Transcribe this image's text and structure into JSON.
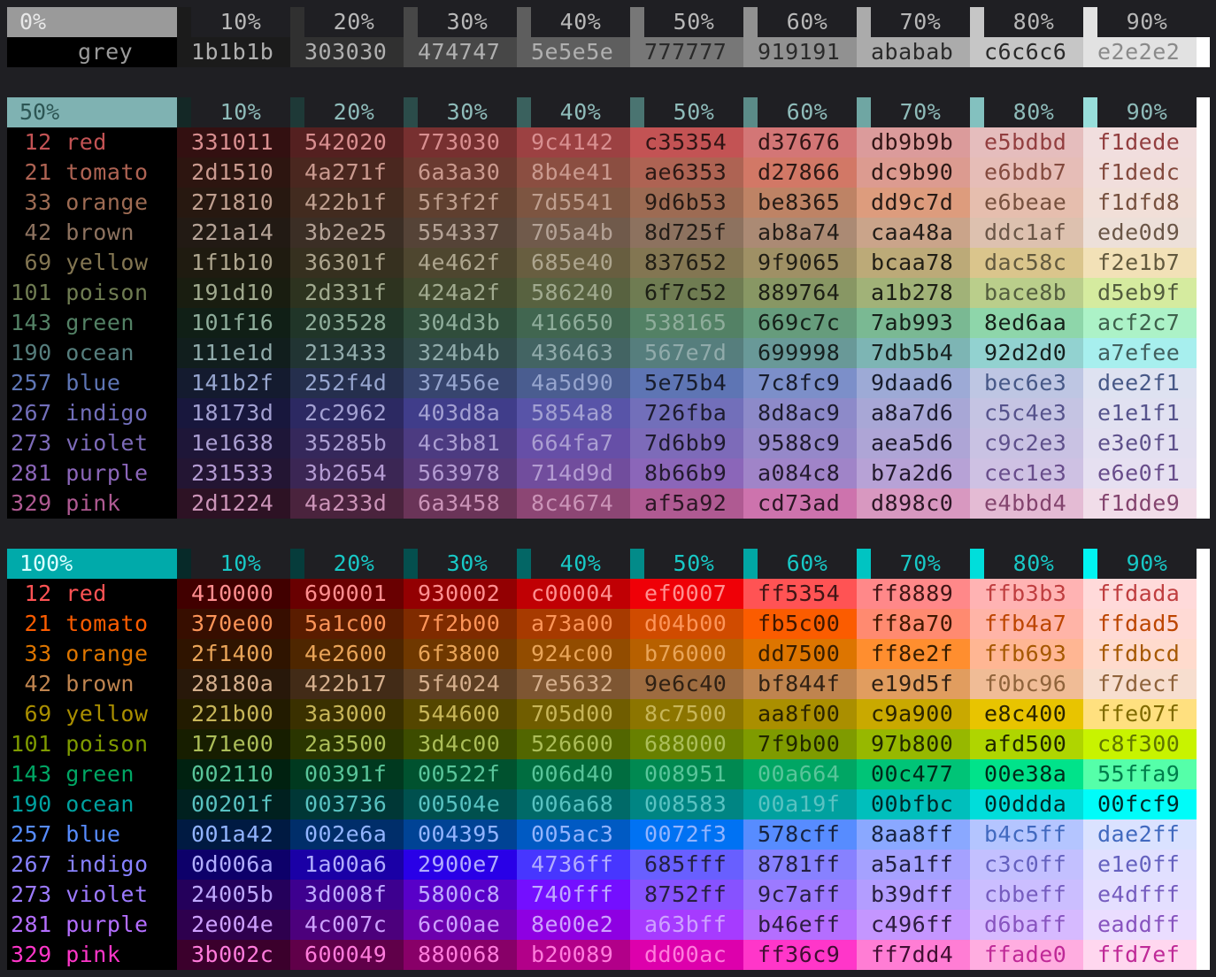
{
  "grey": {
    "header_label": "0%",
    "name": "grey",
    "percent_labels": [
      "10%",
      "20%",
      "30%",
      "40%",
      "50%",
      "60%",
      "70%",
      "80%",
      "90%"
    ],
    "values": [
      "1b1b1b",
      "303030",
      "474747",
      "5e5e5e",
      "777777",
      "919191",
      "ababab",
      "c6c6c6",
      "e2e2e2"
    ]
  },
  "mid": {
    "header_label": "50%",
    "header_color": "#7fb2b2",
    "percent_labels": [
      "10%",
      "20%",
      "30%",
      "40%",
      "50%",
      "60%",
      "70%",
      "80%",
      "90%"
    ],
    "swatch_colors": [
      "#142826",
      "#1e3937",
      "#2b4c4a",
      "#3a615e",
      "#4a7471",
      "#5b8b88",
      "#6fa6a3",
      "#83c1bf",
      "#98dedb"
    ],
    "rows": [
      {
        "label": " 12 red",
        "color": "#c35354",
        "values": [
          "331011",
          "542020",
          "773030",
          "9c4142",
          "c35354",
          "d37676",
          "db9b9b",
          "e5bdbd",
          "f1dede"
        ]
      },
      {
        "label": " 21 tomato",
        "color": "#ae6353",
        "values": [
          "2d1510",
          "4a271f",
          "6a3a30",
          "8b4e41",
          "ae6353",
          "d27866",
          "dc9b90",
          "e6bdb7",
          "f1dedc"
        ]
      },
      {
        "label": " 33 orange",
        "color": "#9d6b53",
        "values": [
          "271810",
          "422b1f",
          "5f3f2f",
          "7d5541",
          "9d6b53",
          "be8365",
          "dd9c7d",
          "e6beae",
          "f1dfd8"
        ]
      },
      {
        "label": " 42 brown",
        "color": "#8d725f",
        "values": [
          "221a14",
          "3b2e25",
          "554337",
          "705a4b",
          "8d725f",
          "ab8a74",
          "caa48a",
          "ddc1af",
          "ede0d9"
        ]
      },
      {
        "label": " 69 yellow",
        "color": "#837652",
        "values": [
          "1f1b10",
          "36301f",
          "4e462f",
          "685e40",
          "837652",
          "9f9065",
          "bcaa78",
          "dac58c",
          "f2e1b7"
        ]
      },
      {
        "label": "101 poison",
        "color": "#6f7c52",
        "values": [
          "191d10",
          "2d331f",
          "424a2f",
          "586240",
          "6f7c52",
          "889764",
          "a1b278",
          "bace8b",
          "d5eb9f"
        ]
      },
      {
        "label": "143 green",
        "color": "#538165",
        "values": [
          "101f16",
          "203528",
          "304d3b",
          "416650",
          "538165",
          "669c7c",
          "7ab993",
          "8ed6aa",
          "acf2c7"
        ]
      },
      {
        "label": "190 ocean",
        "color": "#567e7d",
        "values": [
          "111e1d",
          "213433",
          "324b4b",
          "436463",
          "567e7d",
          "699998",
          "7db5b4",
          "92d2d0",
          "a7efee"
        ]
      },
      {
        "label": "257 blue",
        "color": "#5e75b4",
        "values": [
          "141b2f",
          "252f4d",
          "37456e",
          "4a5d90",
          "5e75b4",
          "7c8fc9",
          "9daad6",
          "bec6e3",
          "dee2f1"
        ]
      },
      {
        "label": "267 indigo",
        "color": "#726fba",
        "values": [
          "18173d",
          "2c2962",
          "403d8a",
          "5854a8",
          "726fba",
          "8d8ac9",
          "a8a7d6",
          "c5c4e3",
          "e1e1f1"
        ]
      },
      {
        "label": "273 violet",
        "color": "#7d6bb9",
        "values": [
          "1e1638",
          "35285b",
          "4c3b81",
          "664fa7",
          "7d6bb9",
          "9588c9",
          "aea5d6",
          "c9c2e3",
          "e3e0f1"
        ]
      },
      {
        "label": "281 purple",
        "color": "#8b66b9",
        "values": [
          "231533",
          "3b2654",
          "563978",
          "714d9d",
          "8b66b9",
          "a084c8",
          "b7a2d6",
          "cec1e3",
          "e6e0f1"
        ]
      },
      {
        "label": "329 pink",
        "color": "#af5a92",
        "values": [
          "2d1224",
          "4a233d",
          "6a3458",
          "8c4674",
          "af5a92",
          "cd73ad",
          "d898c0",
          "e4bbd4",
          "f1dde9"
        ]
      }
    ]
  },
  "full": {
    "header_label": "100%",
    "header_color": "#00aaaa",
    "percent_labels": [
      "10%",
      "20%",
      "30%",
      "40%",
      "50%",
      "60%",
      "70%",
      "80%",
      "90%"
    ],
    "swatch_colors": [
      "#072a29",
      "#063c3b",
      "#044f4e",
      "#036665",
      "#028b89",
      "#01a6a4",
      "#00c4c2",
      "#00dedb",
      "#00f4f1"
    ],
    "rows": [
      {
        "label": " 12 red",
        "color": "#ff5354",
        "values": [
          "410000",
          "690001",
          "930002",
          "c00004",
          "ef0007",
          "ff5354",
          "ff8889",
          "ffb3b3",
          "ffdada"
        ]
      },
      {
        "label": " 21 tomato",
        "color": "#fb5c00",
        "values": [
          "370e00",
          "5a1c00",
          "7f2b00",
          "a73a00",
          "d04b00",
          "fb5c00",
          "ff8a70",
          "ffb4a7",
          "ffdad5"
        ]
      },
      {
        "label": " 33 orange",
        "color": "#dd7500",
        "values": [
          "2f1400",
          "4e2600",
          "6f3800",
          "924c00",
          "b76000",
          "dd7500",
          "ff8e2f",
          "ffb693",
          "ffdbcd"
        ]
      },
      {
        "label": " 42 brown",
        "color": "#bf844f",
        "values": [
          "28180a",
          "422b17",
          "5f4024",
          "7e5632",
          "9e6c40",
          "bf844f",
          "e19d5f",
          "f0bc96",
          "f7decf"
        ]
      },
      {
        "label": " 69 yellow",
        "color": "#aa8f00",
        "values": [
          "221b00",
          "3a3000",
          "544600",
          "705d00",
          "8c7500",
          "aa8f00",
          "c9a900",
          "e8c400",
          "ffe07f"
        ]
      },
      {
        "label": "101 poison",
        "color": "#7f9b00",
        "values": [
          "171e00",
          "2a3500",
          "3d4c00",
          "526600",
          "688000",
          "7f9b00",
          "97b800",
          "afd500",
          "c8f300"
        ]
      },
      {
        "label": "143 green",
        "color": "#00a664",
        "values": [
          "002110",
          "00391f",
          "00522f",
          "006d40",
          "008951",
          "00a664",
          "00c477",
          "00e38a",
          "55ffa9"
        ]
      },
      {
        "label": "190 ocean",
        "color": "#00a19f",
        "values": [
          "00201f",
          "003736",
          "00504e",
          "006a68",
          "008583",
          "00a19f",
          "00bfbc",
          "00ddda",
          "00fcf9"
        ]
      },
      {
        "label": "257 blue",
        "color": "#578cff",
        "values": [
          "001a42",
          "002e6a",
          "004395",
          "005ac3",
          "0072f3",
          "578cff",
          "8aa8ff",
          "b4c5ff",
          "dae2ff"
        ]
      },
      {
        "label": "267 indigo",
        "color": "#8781ff",
        "values": [
          "0d006a",
          "1a00a6",
          "2900e7",
          "4736ff",
          "685fff",
          "8781ff",
          "a5a1ff",
          "c3c0ff",
          "e1e0ff"
        ]
      },
      {
        "label": "273 violet",
        "color": "#9c7aff",
        "values": [
          "24005b",
          "3d008f",
          "5800c8",
          "740fff",
          "8752ff",
          "9c7aff",
          "b39dff",
          "cbbeff",
          "e4dfff"
        ]
      },
      {
        "label": "281 purple",
        "color": "#b46eff",
        "values": [
          "2e004e",
          "4c007c",
          "6c00ae",
          "8e00e2",
          "a63bff",
          "b46eff",
          "c496ff",
          "d6baff",
          "eaddff"
        ]
      },
      {
        "label": "329 pink",
        "color": "#ff36c9",
        "values": [
          "3b002c",
          "600049",
          "880068",
          "b20089",
          "dd00ac",
          "ff36c9",
          "ff7dd4",
          "ffade0",
          "ffd7ef"
        ]
      }
    ]
  }
}
